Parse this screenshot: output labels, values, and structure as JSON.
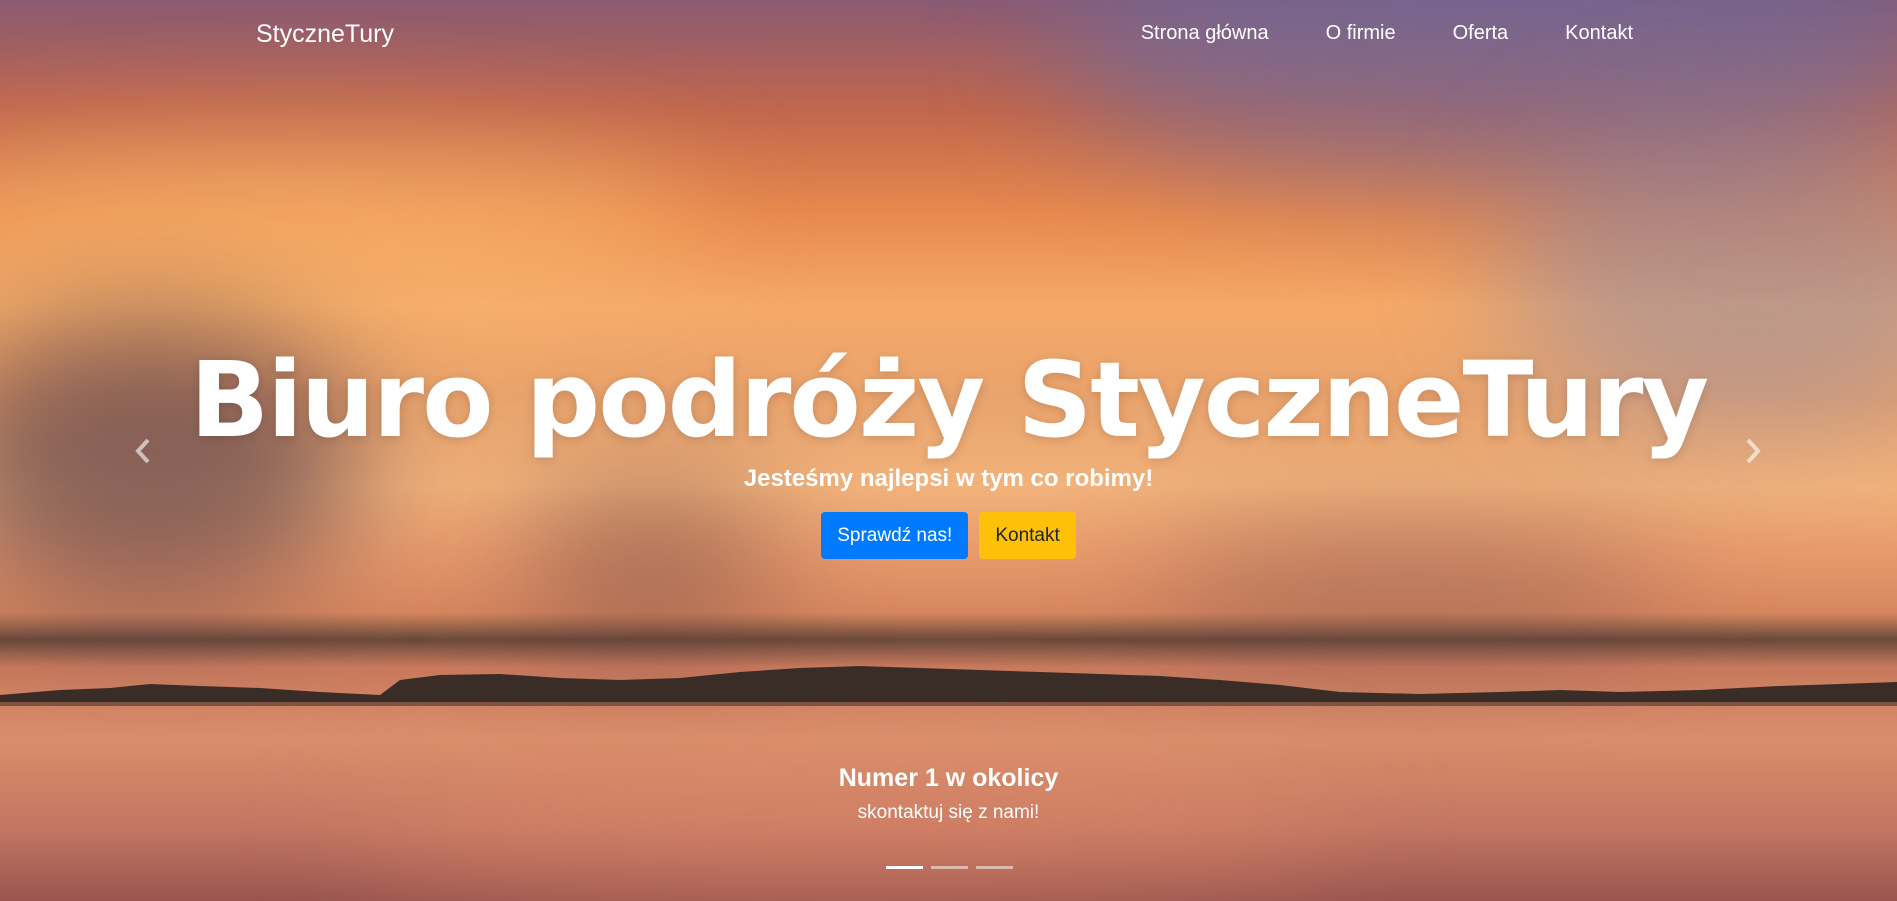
{
  "navbar": {
    "brand": "StyczneTury",
    "links": [
      "Strona główna",
      "O firmie",
      "Oferta",
      "Kontakt"
    ]
  },
  "hero": {
    "title": "Biuro podróży StyczneTury",
    "subtitle": "Jesteśmy najlepsi w tym co robimy!",
    "buttons": {
      "primary": "Sprawdź nas!",
      "secondary": "Kontakt"
    }
  },
  "slide": {
    "title": "Numer 1 w okolicy",
    "text": "skontaktuj się z nami!"
  },
  "carousel": {
    "slide_count": 3,
    "active_index": 0,
    "prev_icon": "chevron-left-icon",
    "next_icon": "chevron-right-icon"
  },
  "colors": {
    "primary_button": "#007bff",
    "secondary_button": "#ffc107"
  }
}
